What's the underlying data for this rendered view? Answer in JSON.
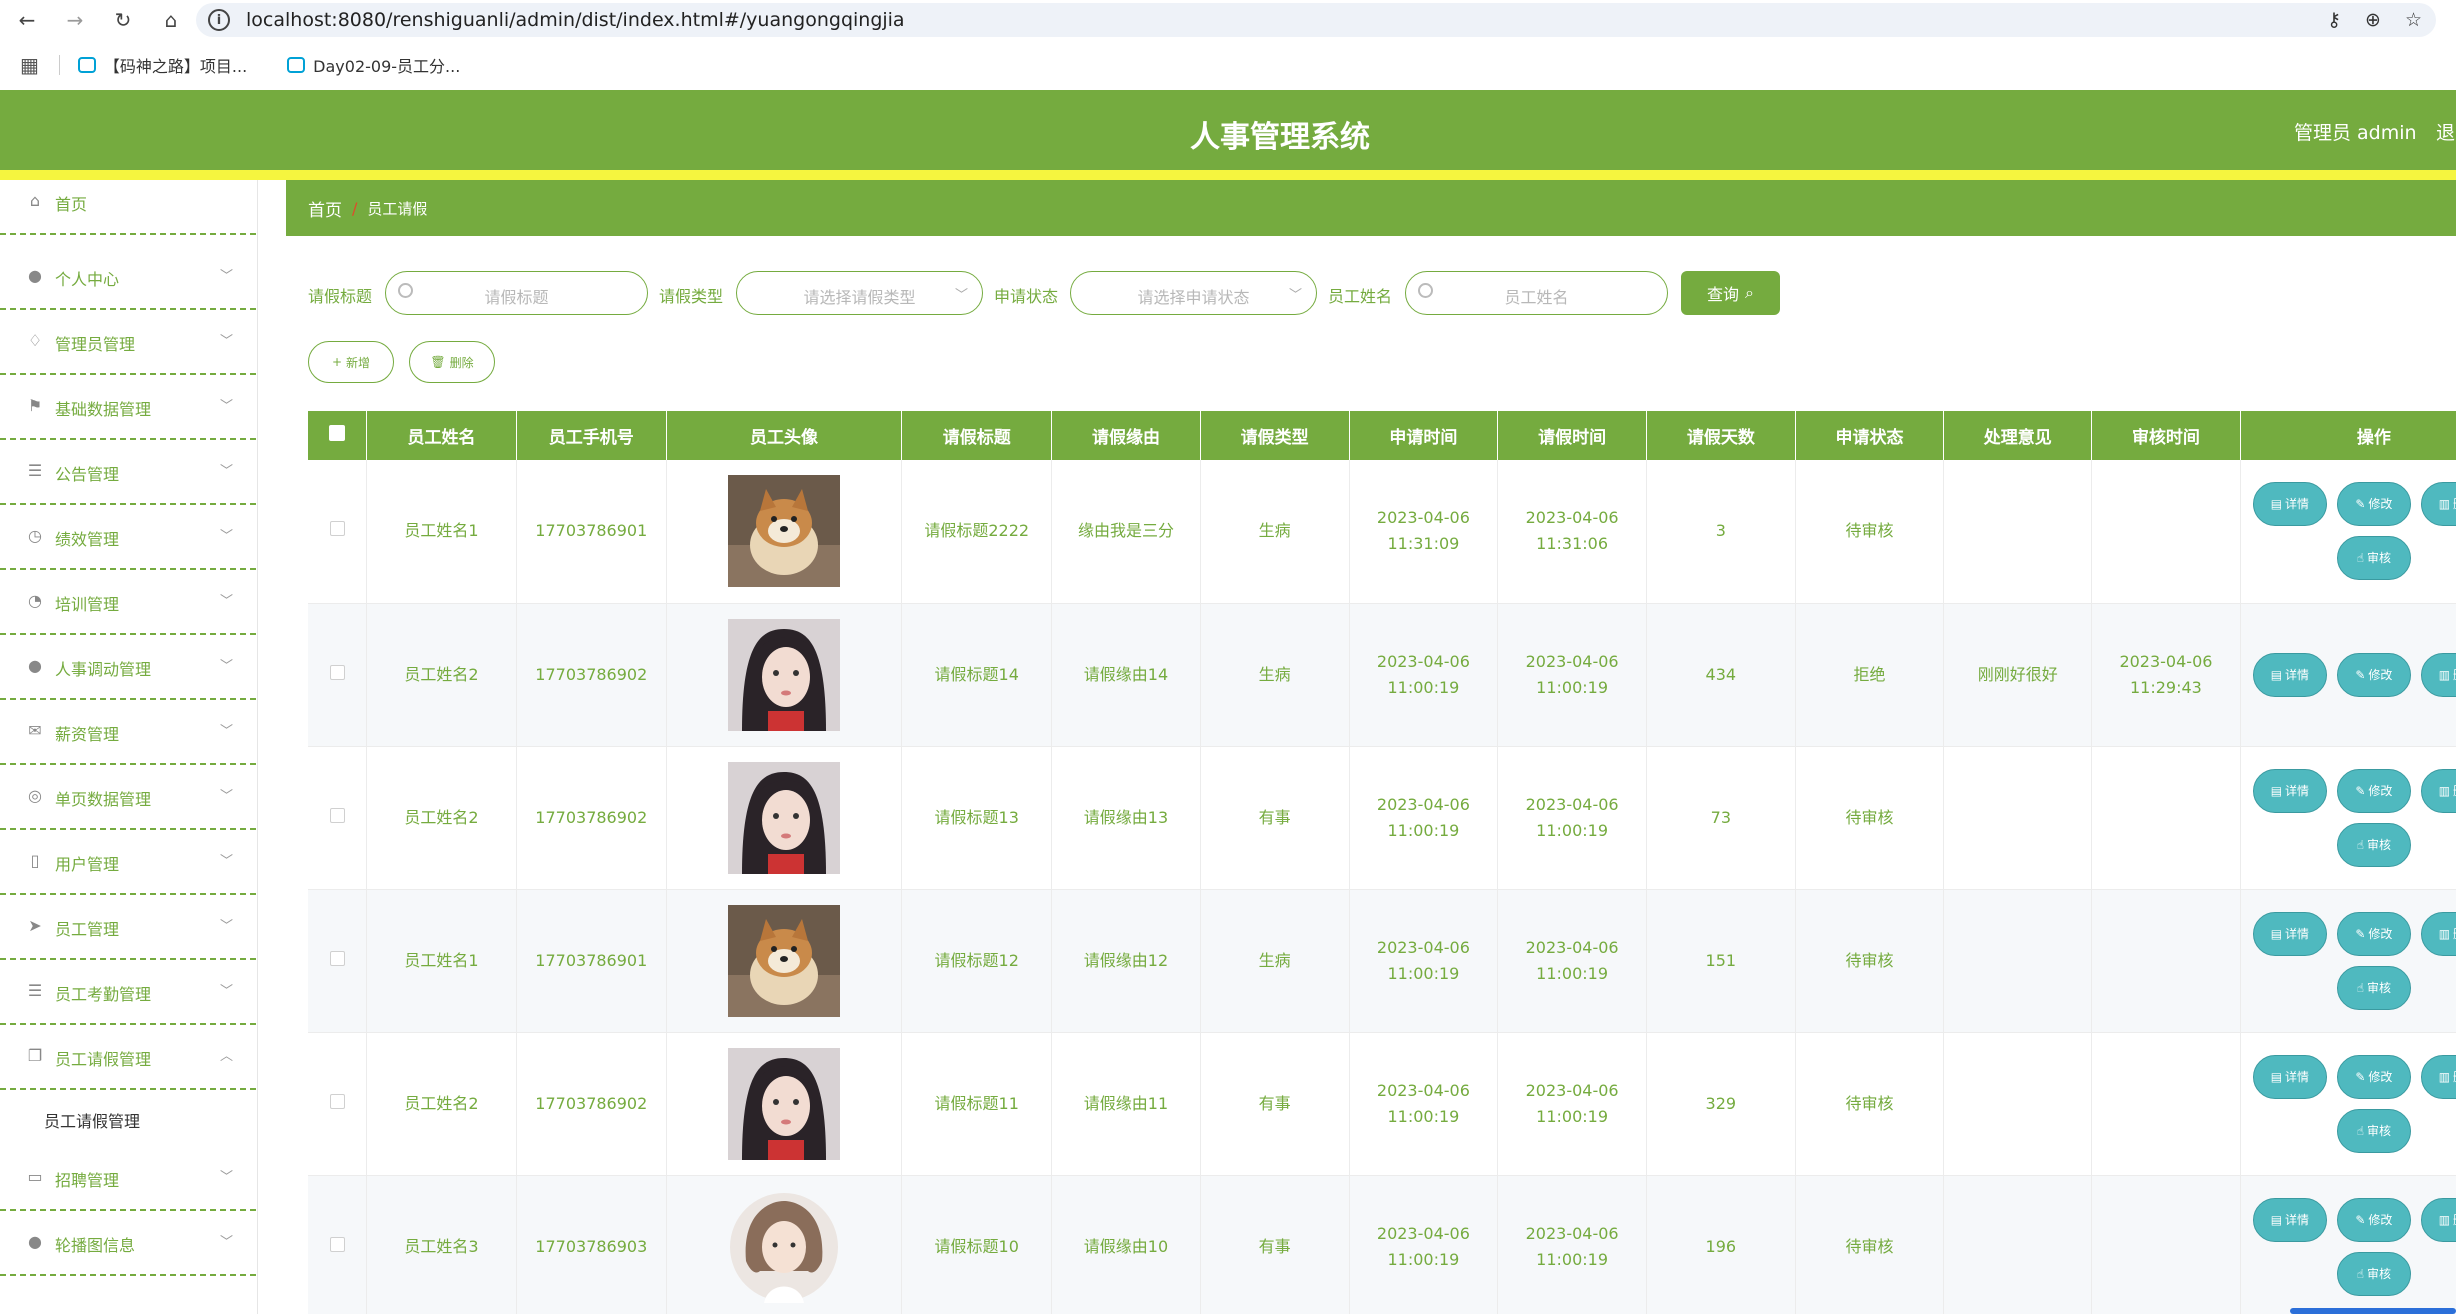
{
  "browser": {
    "url": "localhost:8080/renshiguanli/admin/dist/index.html#/yuangongqingjia",
    "bookmarks": [
      "【码神之路】项目...",
      "Day02-09-员工分..."
    ]
  },
  "header": {
    "title": "人事管理系统",
    "user": "管理员 admin",
    "logout": "退"
  },
  "sidebar": {
    "items": [
      {
        "label": "首页",
        "icon": "home-icon",
        "glyph": "⌂",
        "has_arrow": false
      },
      {
        "label": "个人中心",
        "icon": "user-icon",
        "glyph": "●",
        "has_arrow": true
      },
      {
        "label": "管理员管理",
        "icon": "bell-icon",
        "glyph": "♢",
        "has_arrow": true
      },
      {
        "label": "基础数据管理",
        "icon": "flag-icon",
        "glyph": "⚑",
        "has_arrow": true
      },
      {
        "label": "公告管理",
        "icon": "list-icon",
        "glyph": "☰",
        "has_arrow": true
      },
      {
        "label": "绩效管理",
        "icon": "clock-icon",
        "glyph": "◷",
        "has_arrow": true
      },
      {
        "label": "培训管理",
        "icon": "compass-icon",
        "glyph": "◔",
        "has_arrow": true
      },
      {
        "label": "人事调动管理",
        "icon": "person-icon",
        "glyph": "●",
        "has_arrow": true
      },
      {
        "label": "薪资管理",
        "icon": "mail-icon",
        "glyph": "✉",
        "has_arrow": true
      },
      {
        "label": "单页数据管理",
        "icon": "settings-icon",
        "glyph": "◎",
        "has_arrow": true
      },
      {
        "label": "用户管理",
        "icon": "mic-icon",
        "glyph": "▯",
        "has_arrow": true
      },
      {
        "label": "员工管理",
        "icon": "send-icon",
        "glyph": "➤",
        "has_arrow": true
      },
      {
        "label": "员工考勤管理",
        "icon": "list-icon",
        "glyph": "☰",
        "has_arrow": true
      },
      {
        "label": "员工请假管理",
        "icon": "copy-icon",
        "glyph": "❐",
        "has_arrow": true,
        "open": true
      },
      {
        "label": "招聘管理",
        "icon": "card-icon",
        "glyph": "▭",
        "has_arrow": true
      },
      {
        "label": "轮播图信息",
        "icon": "person-icon",
        "glyph": "●",
        "has_arrow": true
      }
    ],
    "sub_item": "员工请假管理"
  },
  "breadcrumb": {
    "home": "首页",
    "sep": "/",
    "current": "员工请假"
  },
  "search": {
    "title_label": "请假标题",
    "title_placeholder": "请假标题",
    "type_label": "请假类型",
    "type_placeholder": "请选择请假类型",
    "status_label": "申请状态",
    "status_placeholder": "请选择申请状态",
    "name_label": "员工姓名",
    "name_placeholder": "员工姓名",
    "query_button": "查询"
  },
  "actions": {
    "add": "新增",
    "delete": "删除"
  },
  "table": {
    "headers": [
      "员工姓名",
      "员工手机号",
      "员工头像",
      "请假标题",
      "请假缘由",
      "请假类型",
      "申请时间",
      "请假时间",
      "请假天数",
      "申请状态",
      "处理意见",
      "审核时间",
      "操作"
    ],
    "ops": {
      "detail": "详情",
      "edit": "修改",
      "delete": "删除",
      "review": "审核"
    },
    "rows": [
      {
        "name": "员工姓名1",
        "phone": "17703786901",
        "avatar": "dog",
        "title": "请假标题2222",
        "reason": "缘由我是三分",
        "type": "生病",
        "apply_time": "2023-04-06 11:31:09",
        "leave_time": "2023-04-06 11:31:06",
        "days": "3",
        "status": "待审核",
        "opinion": "",
        "review_time": "",
        "can_review": true
      },
      {
        "name": "员工姓名2",
        "phone": "17703786902",
        "avatar": "girl",
        "title": "请假标题14",
        "reason": "请假缘由14",
        "type": "生病",
        "apply_time": "2023-04-06 11:00:19",
        "leave_time": "2023-04-06 11:00:19",
        "days": "434",
        "status": "拒绝",
        "opinion": "刚刚好很好",
        "review_time": "2023-04-06 11:29:43",
        "can_review": false
      },
      {
        "name": "员工姓名2",
        "phone": "17703786902",
        "avatar": "girl",
        "title": "请假标题13",
        "reason": "请假缘由13",
        "type": "有事",
        "apply_time": "2023-04-06 11:00:19",
        "leave_time": "2023-04-06 11:00:19",
        "days": "73",
        "status": "待审核",
        "opinion": "",
        "review_time": "",
        "can_review": true
      },
      {
        "name": "员工姓名1",
        "phone": "17703786901",
        "avatar": "dog",
        "title": "请假标题12",
        "reason": "请假缘由12",
        "type": "生病",
        "apply_time": "2023-04-06 11:00:19",
        "leave_time": "2023-04-06 11:00:19",
        "days": "151",
        "status": "待审核",
        "opinion": "",
        "review_time": "",
        "can_review": true
      },
      {
        "name": "员工姓名2",
        "phone": "17703786902",
        "avatar": "girl",
        "title": "请假标题11",
        "reason": "请假缘由11",
        "type": "有事",
        "apply_time": "2023-04-06 11:00:19",
        "leave_time": "2023-04-06 11:00:19",
        "days": "329",
        "status": "待审核",
        "opinion": "",
        "review_time": "",
        "can_review": true
      },
      {
        "name": "员工姓名3",
        "phone": "17703786903",
        "avatar": "cartoon",
        "title": "请假标题10",
        "reason": "请假缘由10",
        "type": "有事",
        "apply_time": "2023-04-06 11:00:19",
        "leave_time": "2023-04-06 11:00:19",
        "days": "196",
        "status": "待审核",
        "opinion": "",
        "review_time": "",
        "can_review": true
      }
    ]
  }
}
